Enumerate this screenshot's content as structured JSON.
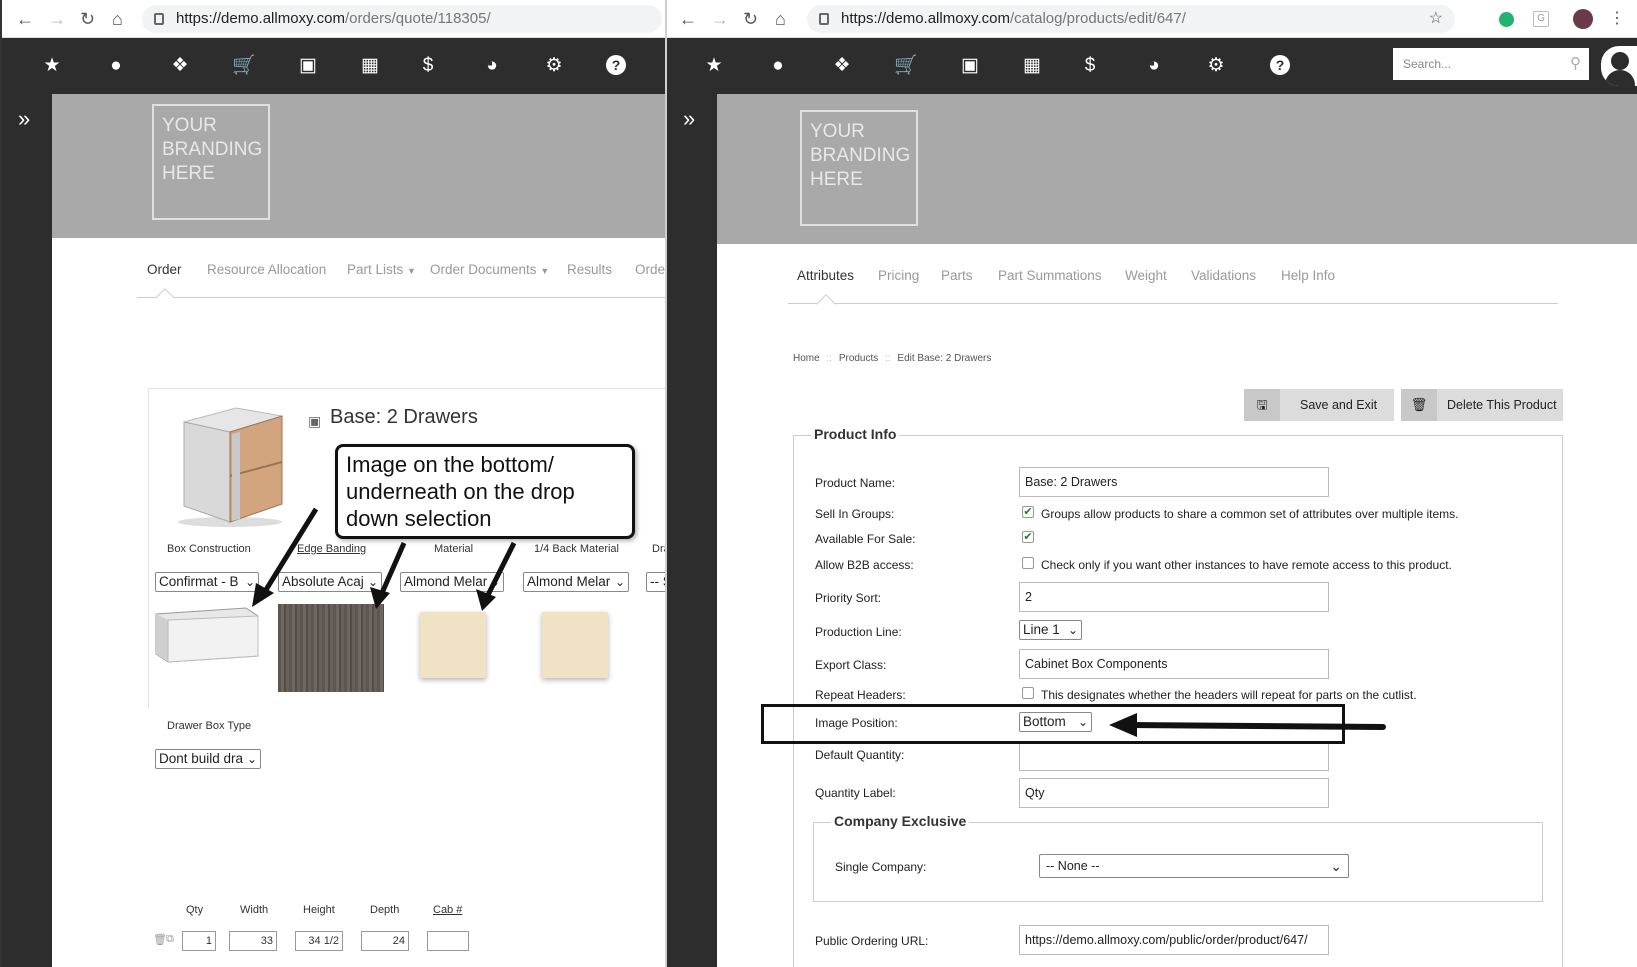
{
  "left": {
    "url_host": "https://demo.allmoxy.com",
    "url_path": "/orders/quote/118305/",
    "logo_text": "YOUR\nBRANDING\nHERE",
    "tabs": [
      "Order",
      "Resource Allocation",
      "Part Lists",
      "Order Documents",
      "Results",
      "Orde"
    ],
    "product_title": "Base: 2 Drawers",
    "attributes": [
      {
        "label": "Box Construction",
        "value": "Confirmat - B"
      },
      {
        "label": "Edge Banding",
        "value": "Absolute Acaj"
      },
      {
        "label": "Material",
        "value": "Almond Melar"
      },
      {
        "label": "1/4 Back Material",
        "value": "Almond Melar"
      },
      {
        "label": "Dra",
        "value": "-- S"
      }
    ],
    "drawer_label": "Drawer Box Type",
    "drawer_value": "Dont build dra",
    "dims": {
      "headers": [
        "Qty",
        "Width",
        "Height",
        "Depth",
        "Cab #"
      ],
      "values": [
        "1",
        "33",
        "34 1/2",
        "24",
        ""
      ]
    },
    "annotation": "Image on the bottom/ underneath on the drop down selection"
  },
  "right": {
    "url_host": "https://demo.allmoxy.com",
    "url_path": "/catalog/products/edit/647/",
    "search_placeholder": "Search...",
    "logo_text": "YOUR\nBRANDING\nHERE",
    "tabs": [
      "Attributes",
      "Pricing",
      "Parts",
      "Part Summations",
      "Weight",
      "Validations",
      "Help Info"
    ],
    "breadcrumb": [
      "Home",
      "Products",
      "Edit Base: 2 Drawers"
    ],
    "breadcrumb_sep": "::",
    "save_button": "Save and Exit",
    "delete_button": "Delete This Product",
    "product_info_legend": "Product Info",
    "fields": {
      "product_name_label": "Product Name:",
      "product_name": "Base: 2 Drawers",
      "sell_in_groups_label": "Sell In Groups:",
      "sell_in_groups_hint": "Groups allow products to share a common set of attributes over multiple items.",
      "available_label": "Available For Sale:",
      "b2b_label": "Allow B2B access:",
      "b2b_hint": "Check only if you want other instances to have remote access to this product.",
      "priority_label": "Priority Sort:",
      "priority": "2",
      "production_line_label": "Production Line:",
      "production_line": "Line 1",
      "export_class_label": "Export Class:",
      "export_class": "Cabinet Box Components",
      "repeat_headers_label": "Repeat Headers:",
      "repeat_headers_hint": "This designates whether the headers will repeat for parts on the cutlist.",
      "image_position_label": "Image Position:",
      "image_position": "Bottom",
      "default_qty_label": "Default Quantity:",
      "default_qty": "",
      "qty_label_label": "Quantity Label:",
      "qty_label": "Qty",
      "company_exclusive_legend": "Company Exclusive",
      "single_company_label": "Single Company:",
      "single_company": "-- None --",
      "public_url_label": "Public Ordering URL:",
      "public_url": "https://demo.allmoxy.com/public/order/product/647/"
    }
  },
  "colors": {
    "toolbar": "#2d2d2d",
    "banner": "#a9a9a9",
    "check": "#2a7a2a"
  }
}
